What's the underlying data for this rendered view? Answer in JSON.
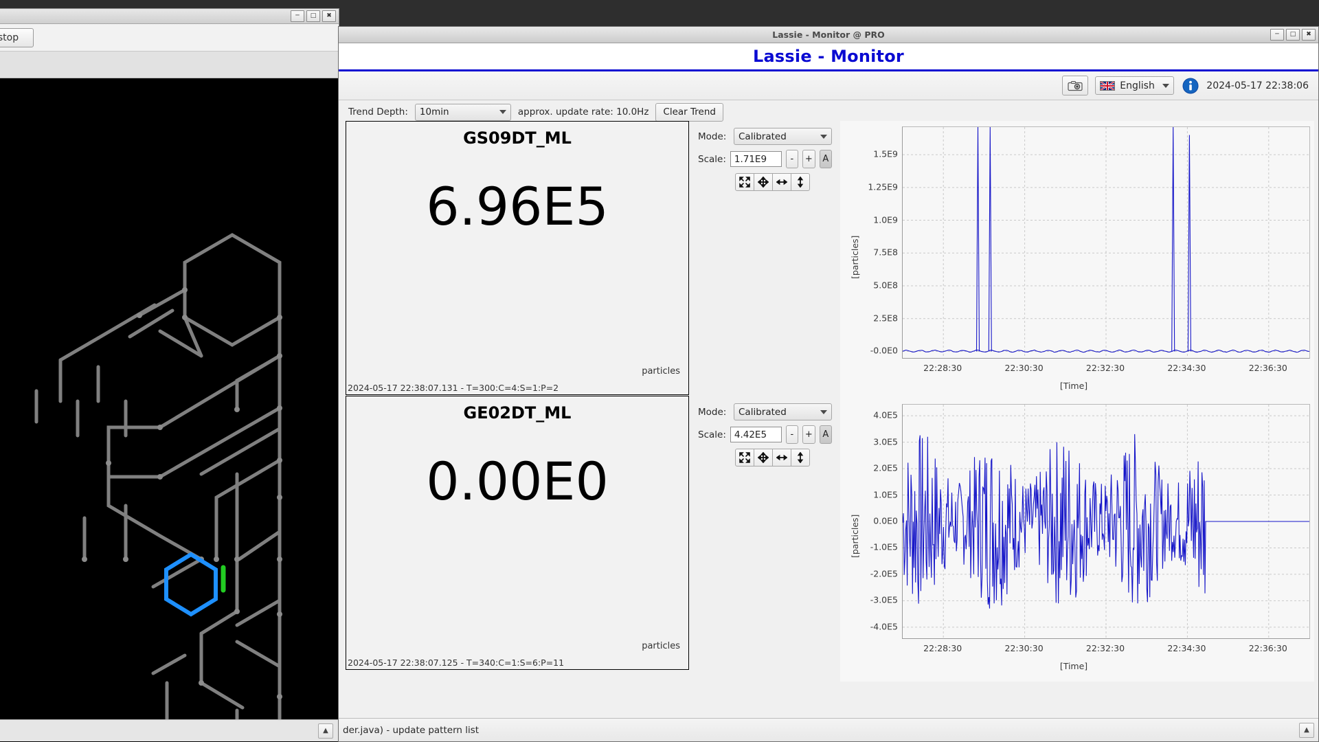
{
  "left_window": {
    "title": "",
    "stop_button": "stop",
    "window_buttons": [
      "minimize",
      "maximize",
      "close"
    ],
    "collapse_icon": "chevron-up-icon"
  },
  "main_window": {
    "titlebar": "Lassie - Monitor @ PRO",
    "app_title": "Lassie - Monitor",
    "accent_color": "#0a0ad2",
    "window_buttons": [
      "minimize",
      "maximize",
      "close"
    ]
  },
  "toolbar": {
    "camera_icon": "camera-icon",
    "language": "English",
    "info_icon": "info-icon",
    "clock": "2024-05-17 22:38:06"
  },
  "trendbar": {
    "depth_label": "Trend Depth:",
    "depth_value": "10min",
    "update_rate": "approx. update rate:  10.0Hz",
    "clear_trend": "Clear Trend"
  },
  "panels": [
    {
      "name": "GS09DT_ML",
      "value": "6.96E5",
      "unit": "particles",
      "stamp": "2024-05-17 22:38:07.131 - T=300:C=4:S=1:P=2",
      "mode_label": "Mode:",
      "mode_value": "Calibrated",
      "scale_label": "Scale:",
      "scale_value": "1.71E9",
      "minus": "-",
      "plus": "+",
      "auto": "A",
      "tool_icons": [
        "expand-icon",
        "move-icon",
        "horizontal-resize-icon",
        "vertical-resize-icon"
      ]
    },
    {
      "name": "GE02DT_ML",
      "value": "0.00E0",
      "unit": "particles",
      "stamp": "2024-05-17 22:38:07.125 - T=340:C=1:S=6:P=11",
      "mode_label": "Mode:",
      "mode_value": "Calibrated",
      "scale_label": "Scale:",
      "scale_value": "4.42E5",
      "minus": "-",
      "plus": "+",
      "auto": "A",
      "tool_icons": [
        "expand-icon",
        "move-icon",
        "horizontal-resize-icon",
        "vertical-resize-icon"
      ]
    }
  ],
  "chart_data": [
    {
      "type": "line",
      "title": "GS09DT_ML trend",
      "xlabel": "[Time]",
      "ylabel": "[particles]",
      "grid": true,
      "series_color": "#1515c8",
      "xticks": [
        "22:28:30",
        "22:30:30",
        "22:32:30",
        "22:34:30",
        "22:36:30"
      ],
      "yticks": [
        "1.5E9",
        "1.25E9",
        "1.0E9",
        "7.5E8",
        "5.0E8",
        "2.5E8",
        "-0.0E0"
      ],
      "ytick_values": [
        1500000000.0,
        1250000000.0,
        1000000000.0,
        750000000.0,
        500000000.0,
        250000000.0,
        0
      ],
      "ylim": [
        -50000000.0,
        1710000000.0
      ],
      "xlim": [
        0,
        1
      ],
      "peaks": [
        {
          "x": 0.185,
          "y": 1710000000.0
        },
        {
          "x": 0.215,
          "y": 1710000000.0
        },
        {
          "x": 0.665,
          "y": 1710000000.0
        },
        {
          "x": 0.705,
          "y": 1650000000.0
        }
      ],
      "baseline": 0.0
    },
    {
      "type": "line",
      "title": "GE02DT_ML trend",
      "xlabel": "[Time]",
      "ylabel": "[particles]",
      "grid": true,
      "series_color": "#1515c8",
      "xticks": [
        "22:28:30",
        "22:30:30",
        "22:32:30",
        "22:34:30",
        "22:36:30"
      ],
      "yticks": [
        "4.0E5",
        "3.0E5",
        "2.0E5",
        "1.0E5",
        "0.0E0",
        "-1.0E5",
        "-2.0E5",
        "-3.0E5",
        "-4.0E5"
      ],
      "ytick_values": [
        400000.0,
        300000.0,
        200000.0,
        100000.0,
        0,
        -100000.0,
        -200000.0,
        -300000.0,
        -400000.0
      ],
      "ylim": [
        -442000.0,
        442000.0
      ],
      "xlim": [
        0,
        1
      ],
      "noise_end_x": 0.745,
      "noise_amplitude": 310000.0,
      "flat_value": 0.0
    }
  ],
  "schematic": {
    "background": "#000000",
    "line_color": "#808080",
    "highlight_color": "#1e90ff",
    "marker_color": "#22cc22",
    "highlight_shape": "hexagon"
  },
  "status_bar": {
    "text": "der.java) - update pattern list",
    "collapse_icon": "chevron-up-icon"
  }
}
